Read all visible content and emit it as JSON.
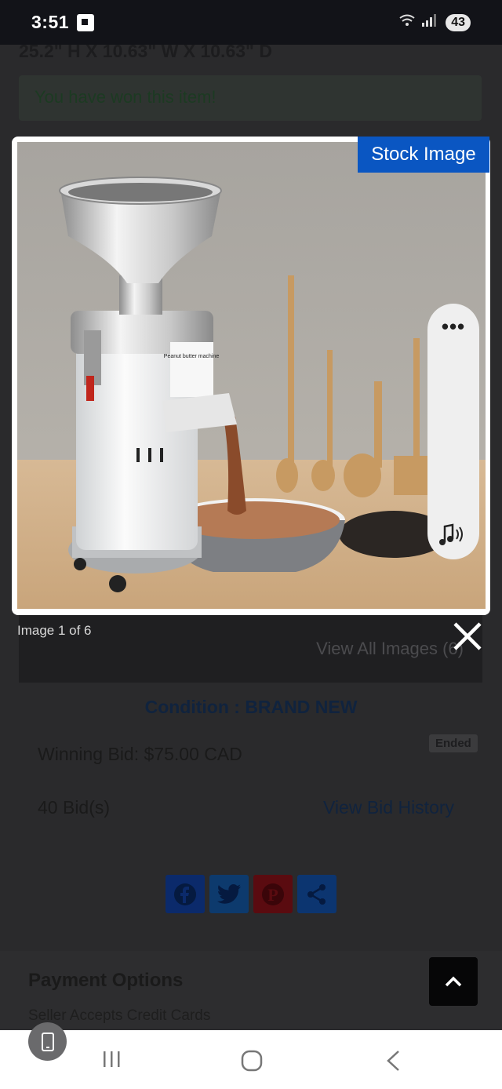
{
  "status_bar": {
    "time": "3:51",
    "battery": "43"
  },
  "page": {
    "dimensions": "25.2\" H X 10.63\" W X 10.63\" D",
    "won_message": "You have won this item!",
    "view_all_images": "View All Images (6)",
    "condition": "Condition : BRAND NEW",
    "winning_bid": "Winning Bid: $75.00 CAD",
    "ended_badge": "Ended",
    "bids_count": "40 Bid(s)",
    "view_bid_history": "View Bid History",
    "payment_title": "Payment Options",
    "payment_text": "Seller Accepts Credit Cards"
  },
  "viewer": {
    "stock_label": "Stock Image",
    "counter": "Image 1 of 6",
    "machine_label": "Peanut butter machine"
  },
  "share_icons": [
    "facebook-icon",
    "twitter-icon",
    "pinterest-icon",
    "share-icon"
  ],
  "colors": {
    "stock_tag": "#0a56c2",
    "status_bg": "#121318",
    "facebook": "#0b2a6b",
    "twitter": "#0d3a6d",
    "pinterest": "#5a0b10",
    "share": "#0c3570"
  }
}
